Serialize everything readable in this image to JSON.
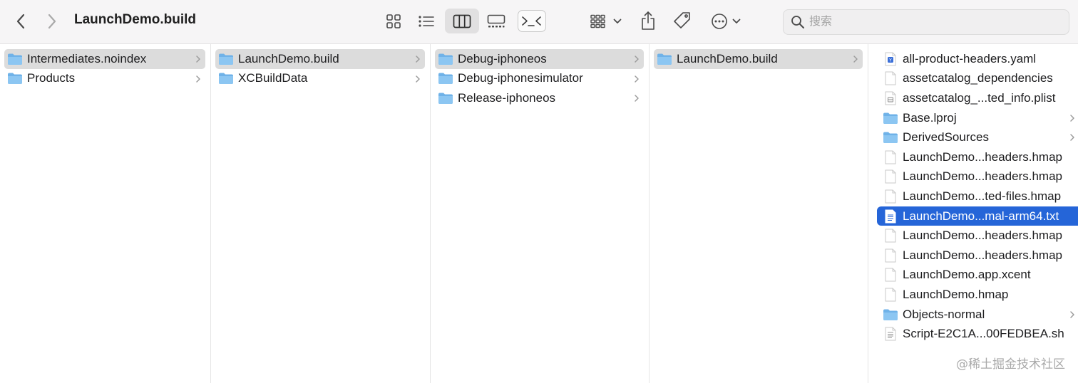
{
  "window": {
    "title": "LaunchDemo.build"
  },
  "toolbar": {
    "back_icon": "chevron-left-icon",
    "forward_icon": "chevron-right-icon",
    "view_icons": "grid-view-icon",
    "view_list": "list-view-icon",
    "view_columns": "column-view-icon",
    "view_gallery": "gallery-view-icon",
    "terminal_icon": "terminal-icon",
    "group_icon": "group-by-icon",
    "share_icon": "share-icon",
    "tag_icon": "tag-icon",
    "more_icon": "ellipsis-circle-icon"
  },
  "search": {
    "placeholder": "搜索",
    "value": ""
  },
  "colors": {
    "selection_blue": "#2565d8",
    "selection_gray": "#dcdcdc",
    "folder": "#6fb2e8"
  },
  "columns": [
    {
      "items": [
        {
          "label": "Intermediates.noindex",
          "kind": "folder",
          "chevron": true,
          "state": "gray"
        },
        {
          "label": "Products",
          "kind": "folder",
          "chevron": true,
          "state": "none"
        }
      ]
    },
    {
      "items": [
        {
          "label": "LaunchDemo.build",
          "kind": "folder",
          "chevron": true,
          "state": "gray"
        },
        {
          "label": "XCBuildData",
          "kind": "folder",
          "chevron": true,
          "state": "none"
        }
      ]
    },
    {
      "items": [
        {
          "label": "Debug-iphoneos",
          "kind": "folder",
          "chevron": true,
          "state": "gray"
        },
        {
          "label": "Debug-iphonesimulator",
          "kind": "folder",
          "chevron": true,
          "state": "none"
        },
        {
          "label": "Release-iphoneos",
          "kind": "folder",
          "chevron": true,
          "state": "none"
        }
      ]
    },
    {
      "items": [
        {
          "label": "LaunchDemo.build",
          "kind": "folder",
          "chevron": true,
          "state": "gray"
        }
      ]
    },
    {
      "items": [
        {
          "label": "all-product-headers.yaml",
          "kind": "yaml",
          "chevron": false,
          "state": "none"
        },
        {
          "label": "assetcatalog_dependencies",
          "kind": "doc",
          "chevron": false,
          "state": "none"
        },
        {
          "label": "assetcatalog_...ted_info.plist",
          "kind": "plist",
          "chevron": false,
          "state": "none"
        },
        {
          "label": "Base.lproj",
          "kind": "folder",
          "chevron": true,
          "state": "none"
        },
        {
          "label": "DerivedSources",
          "kind": "folder",
          "chevron": true,
          "state": "none"
        },
        {
          "label": "LaunchDemo...headers.hmap",
          "kind": "doc",
          "chevron": false,
          "state": "none"
        },
        {
          "label": "LaunchDemo...headers.hmap",
          "kind": "doc",
          "chevron": false,
          "state": "none"
        },
        {
          "label": "LaunchDemo...ted-files.hmap",
          "kind": "doc",
          "chevron": false,
          "state": "none"
        },
        {
          "label": "LaunchDemo...mal-arm64.txt",
          "kind": "text",
          "chevron": false,
          "state": "blue"
        },
        {
          "label": "LaunchDemo...headers.hmap",
          "kind": "doc",
          "chevron": false,
          "state": "none"
        },
        {
          "label": "LaunchDemo...headers.hmap",
          "kind": "doc",
          "chevron": false,
          "state": "none"
        },
        {
          "label": "LaunchDemo.app.xcent",
          "kind": "doc",
          "chevron": false,
          "state": "none"
        },
        {
          "label": "LaunchDemo.hmap",
          "kind": "doc",
          "chevron": false,
          "state": "none"
        },
        {
          "label": "Objects-normal",
          "kind": "folder",
          "chevron": true,
          "state": "none"
        },
        {
          "label": "Script-E2C1A...00FEDBEA.sh",
          "kind": "text",
          "chevron": false,
          "state": "none"
        }
      ]
    }
  ],
  "watermark": "@稀土掘金技术社区"
}
